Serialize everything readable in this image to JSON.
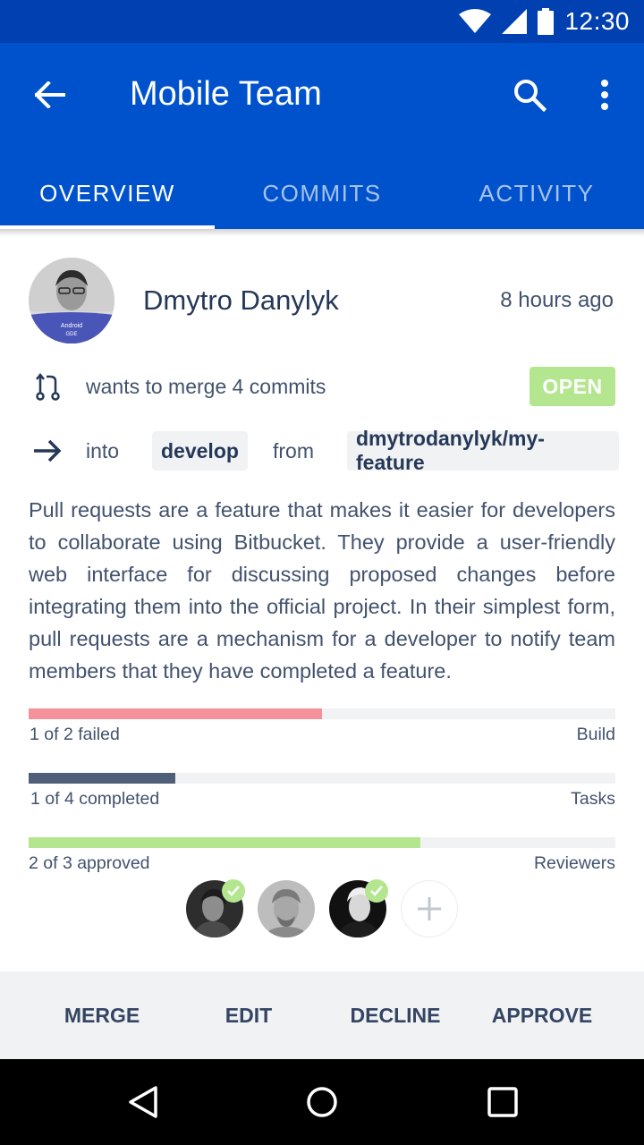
{
  "status_bar": {
    "time": "12:30"
  },
  "app_bar": {
    "title": "Mobile Team"
  },
  "tabs": [
    {
      "label": "OVERVIEW",
      "active": true
    },
    {
      "label": "COMMITS",
      "active": false
    },
    {
      "label": "ACTIVITY",
      "active": false
    }
  ],
  "pull_request": {
    "author": "Dmytro Danylyk",
    "time_ago": "8 hours ago",
    "avatar_badge_line1": "Android",
    "avatar_badge_line2": "GDE",
    "summary": "wants to merge 4 commits",
    "state": "OPEN",
    "into_label": "into",
    "target_branch": "develop",
    "from_label": "from",
    "source_branch": "dmytrodanylyk/my-feature",
    "description": "Pull requests are a feature that makes it easier for developers to collaborate using Bitbucket. They provide a user-friendly web interface for discussing proposed changes before integrating them into the official project. In their simplest form, pull requests are a mechanism for a developer to notify team members that they have completed a feature."
  },
  "checks": {
    "build": {
      "status": "1 of 2 failed",
      "label": "Build",
      "progress": 0.5,
      "color": "#f4919a"
    },
    "tasks": {
      "status": "1 of 4 completed",
      "label": "Tasks",
      "progress": 0.25,
      "color": "#505f79"
    },
    "reviewers": {
      "status": "2 of 3 approved",
      "label": "Reviewers",
      "progress": 0.667,
      "color": "#b3e68f"
    }
  },
  "reviewer_list": [
    {
      "name": "reviewer-1",
      "approved": true
    },
    {
      "name": "reviewer-2",
      "approved": false
    },
    {
      "name": "reviewer-3",
      "approved": true
    }
  ],
  "actions": {
    "merge": "MERGE",
    "edit": "EDIT",
    "decline": "DECLINE",
    "approve": "APPROVE"
  },
  "colors": {
    "status_bar": "#0040b0",
    "app_bar": "#0052cc",
    "open_badge": "#b3e68f",
    "text_primary": "#253858",
    "text_secondary": "#42526e"
  },
  "icons": {
    "back": "arrow-left-icon",
    "search": "search-icon",
    "more": "more-vert-icon",
    "merge": "pull-request-icon",
    "branch_arrow": "arrow-right-icon",
    "add_reviewer": "plus-icon",
    "nav_back": "nav-back-icon",
    "nav_home": "nav-home-icon",
    "nav_recents": "nav-recents-icon"
  }
}
